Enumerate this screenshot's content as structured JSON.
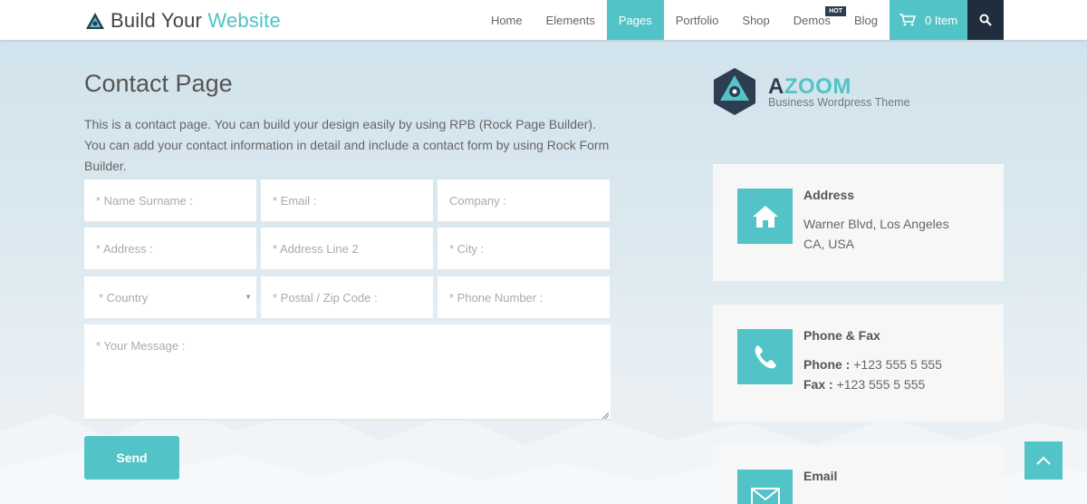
{
  "header": {
    "logo": {
      "text_main": "Build Your ",
      "text_accent": "Website"
    },
    "nav": [
      {
        "label": "Home",
        "active": false
      },
      {
        "label": "Elements",
        "active": false
      },
      {
        "label": "Pages",
        "active": true
      },
      {
        "label": "Portfolio",
        "active": false
      },
      {
        "label": "Shop",
        "active": false
      },
      {
        "label": "Demos",
        "active": false,
        "badge": "HOT"
      },
      {
        "label": "Blog",
        "active": false
      }
    ],
    "cart_label": "0 Item"
  },
  "main": {
    "title": "Contact Page",
    "intro": "This is a contact page. You can build your design easily by using RPB (Rock Page Builder). You can add your contact information in detail and include a contact form by using Rock Form Builder.",
    "form": {
      "name_placeholder": "* Name Surname :",
      "email_placeholder": "* Email :",
      "company_placeholder": "Company :",
      "address_placeholder": "* Address :",
      "address2_placeholder": "* Address Line 2",
      "city_placeholder": "* City :",
      "country_placeholder": "* Country",
      "postal_placeholder": "* Postal / Zip Code :",
      "phone_placeholder": "* Phone Number :",
      "message_placeholder": "* Your Message :",
      "send_label": "Send"
    }
  },
  "sidebar": {
    "brand": {
      "first_letter": "A",
      "rest": "ZOOM",
      "subtitle": "Business Wordpress Theme"
    },
    "cards": [
      {
        "title": "Address",
        "icon": "home-icon",
        "line1": "Warner Blvd, Los Angeles",
        "line2": "CA, USA"
      },
      {
        "title": "Phone & Fax",
        "icon": "phone-icon",
        "phone_label": "Phone :",
        "phone_value": " +123 555 5 555",
        "fax_label": "Fax :",
        "fax_value": " +123 555 5 555"
      },
      {
        "title": "Email",
        "icon": "envelope-icon"
      }
    ]
  },
  "colors": {
    "accent": "#52c4c7",
    "dark": "#1f2d3d",
    "card_bg": "#f7f7f7"
  }
}
